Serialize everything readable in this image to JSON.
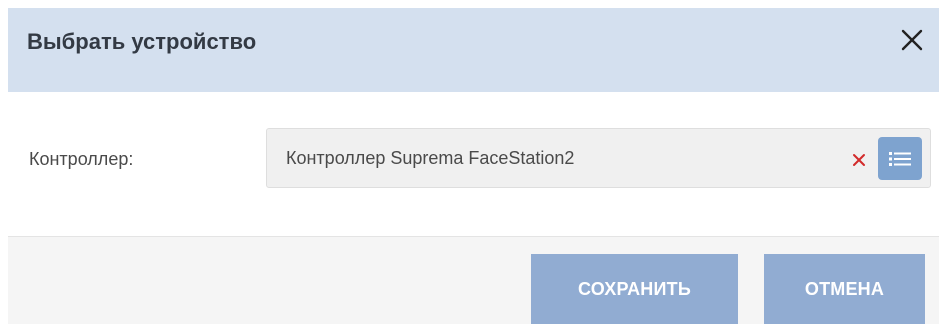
{
  "dialog": {
    "title": "Выбрать устройство",
    "close_icon": "close-icon"
  },
  "form": {
    "controller_label": "Контроллер:",
    "controller_value": "Контроллер Suprema FaceStation2",
    "clear_icon": "clear-icon",
    "list_icon": "list-icon"
  },
  "footer": {
    "save_label": "СОХРАНИТЬ",
    "cancel_label": "ОТМЕНА"
  },
  "colors": {
    "header_bg": "#d4e0ef",
    "button_bg": "#91acd2",
    "list_button_bg": "#7ea3cf",
    "clear_icon": "#d22b2b"
  }
}
